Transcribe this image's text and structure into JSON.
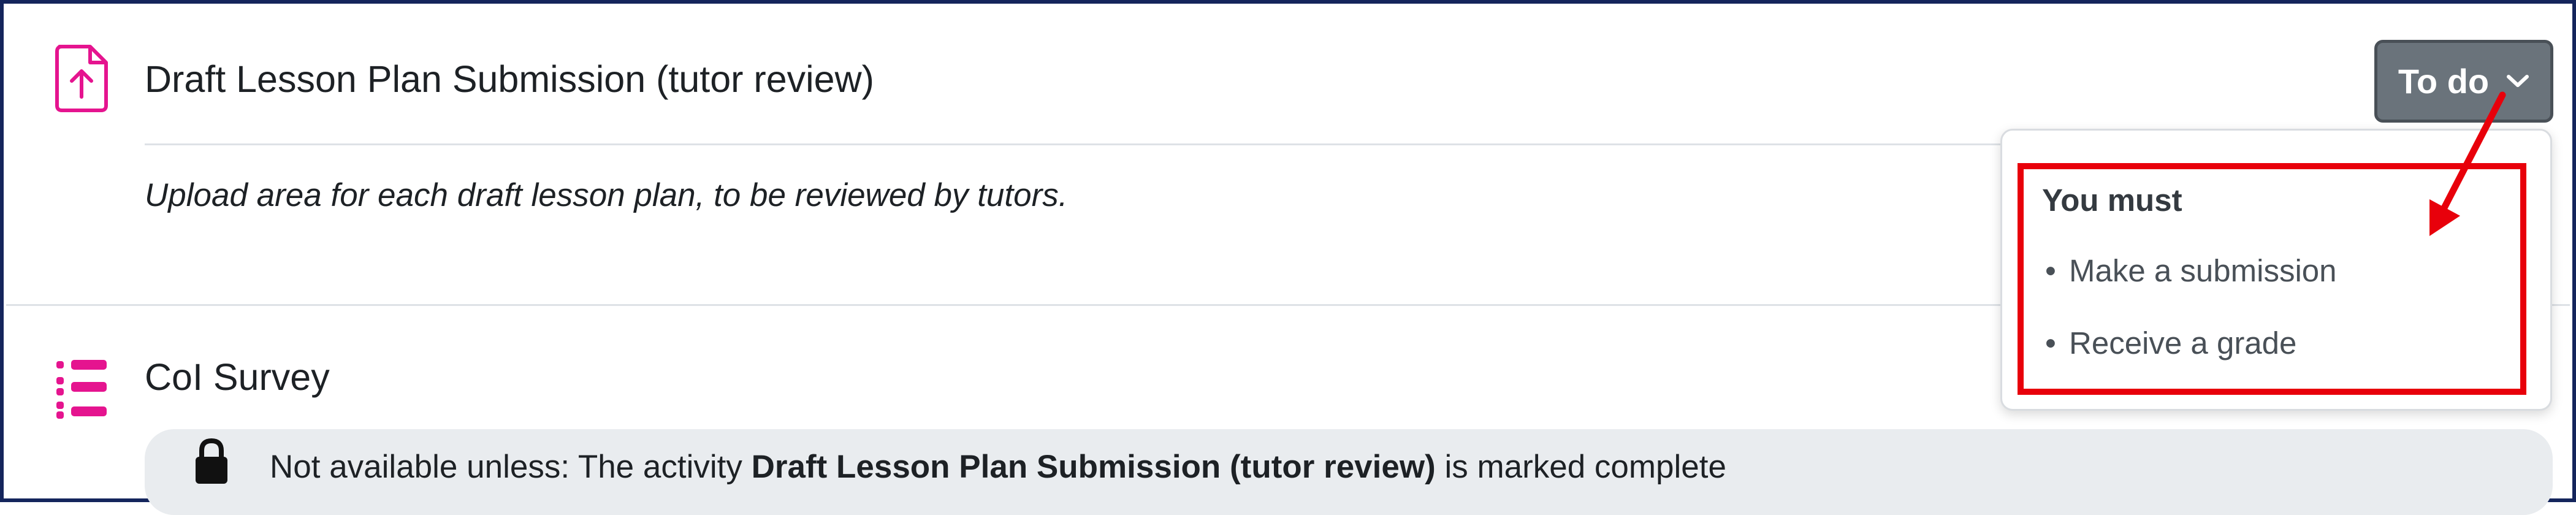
{
  "activities": [
    {
      "icon": "assignment-upload-icon",
      "title": "Draft Lesson Plan Submission (tutor review)",
      "description": "Upload area for each draft lesson plan, to be reviewed by tutors."
    },
    {
      "icon": "survey-list-icon",
      "title": "CoI Survey",
      "restriction": {
        "prefix": "Not available unless: The activity ",
        "activity": "Draft Lesson Plan Submission (tutor review)",
        "suffix": " is marked complete"
      }
    }
  ],
  "completion": {
    "button_label": "To do",
    "heading": "You must",
    "requirements": [
      "Make a submission",
      "Receive a grade"
    ]
  },
  "colors": {
    "icon_pink": "#e5148f",
    "annotation_red": "#e8000b",
    "button_grey": "#6a737b",
    "frame_navy": "#14255c"
  }
}
